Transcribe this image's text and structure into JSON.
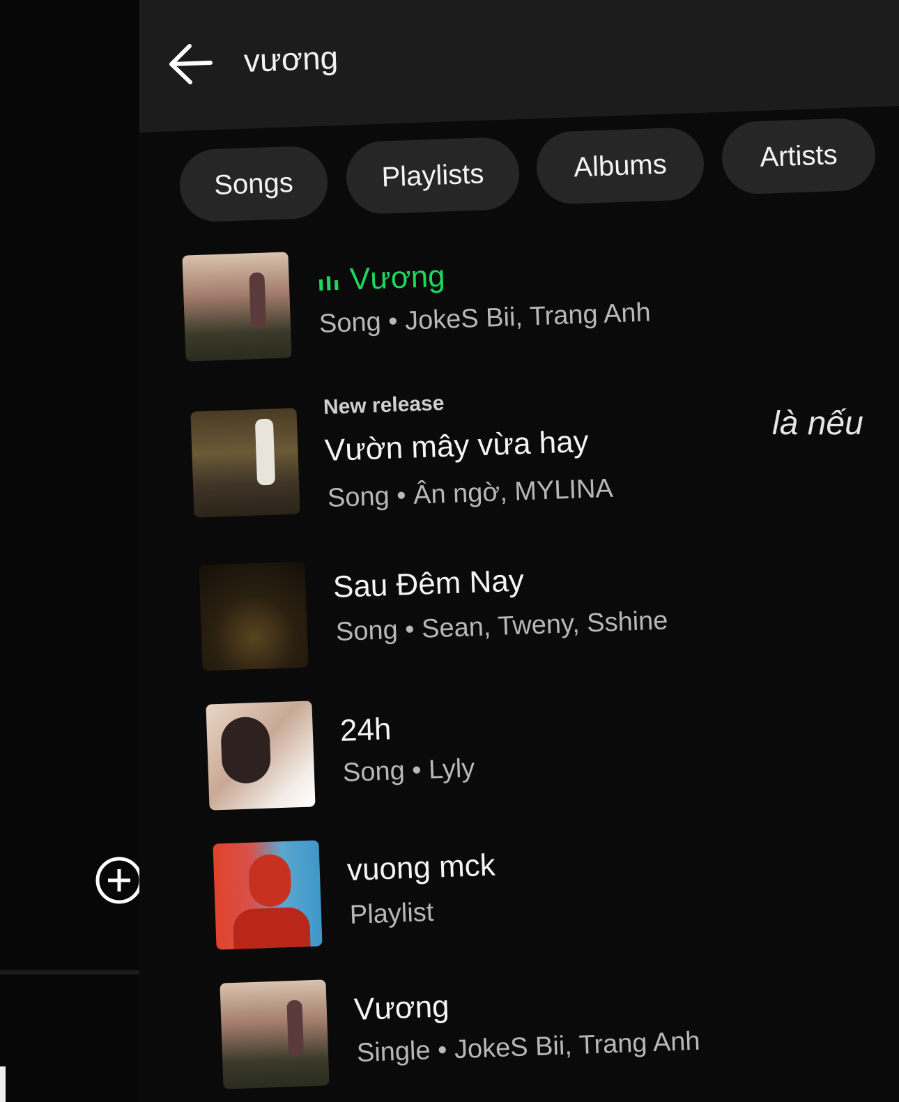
{
  "search": {
    "query": "vương"
  },
  "filters": [
    {
      "label": "Songs"
    },
    {
      "label": "Playlists"
    },
    {
      "label": "Albums"
    },
    {
      "label": "Artists"
    }
  ],
  "results": [
    {
      "title": "Vương",
      "subtitle": "Song • JokeS Bii, Trang Anh",
      "playing": true
    },
    {
      "badge": "New release",
      "title": "Vườn mây vừa hay",
      "subtitle": "Song • Ân ngờ, MYLINA"
    },
    {
      "title": "Sau Đêm Nay",
      "subtitle": "Song • Sean, Tweny, Sshine"
    },
    {
      "title": "24h",
      "subtitle": "Song • Lyly"
    },
    {
      "title": "vuong mck",
      "subtitle": "Playlist"
    },
    {
      "title": "Vương",
      "subtitle": "Single • JokeS Bii, Trang Anh"
    }
  ],
  "overlay_caption": "là nếu",
  "colors": {
    "accent": "#1ed760",
    "background": "#0a0a0a",
    "chip": "#262626"
  },
  "icons": {
    "back": "arrow-left-icon",
    "add": "plus-circle-icon",
    "playing": "equalizer-bars-icon"
  }
}
